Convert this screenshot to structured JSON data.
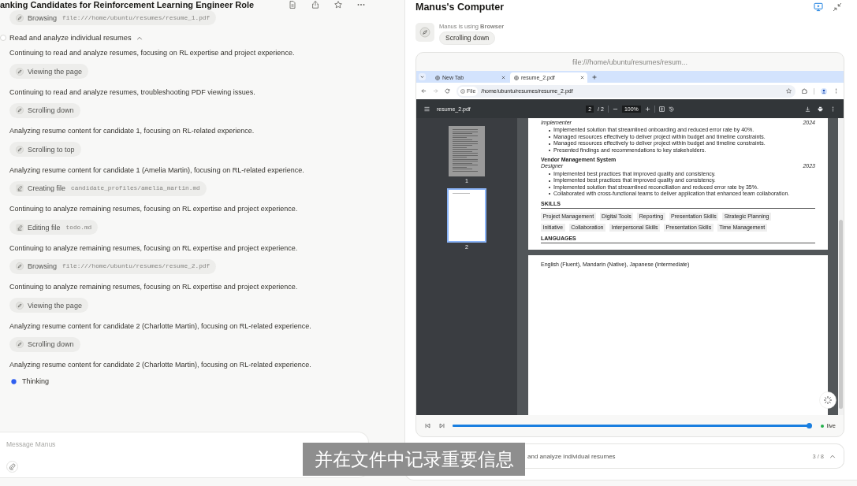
{
  "header": {
    "title": "anking Candidates for Reinforcement Learning Engineer Role"
  },
  "feed": {
    "lead": {
      "kind": "browser",
      "label": "Browsing",
      "detail": "file:///home/ubuntu/resumes/resume_1.pdf"
    },
    "step": {
      "title": "Read and analyze individual resumes",
      "expanded": true
    },
    "entries": [
      {
        "kind": "message",
        "text": "Continuing to read and analyze resumes, focusing on RL expertise and project experience."
      },
      {
        "kind": "browser",
        "label": "Viewing the page"
      },
      {
        "kind": "message",
        "text": "Continuing to read and analyze resumes, troubleshooting PDF viewing issues."
      },
      {
        "kind": "browser",
        "label": "Scrolling down"
      },
      {
        "kind": "message",
        "text": "Analyzing resume content for candidate 1, focusing on RL-related experience."
      },
      {
        "kind": "browser",
        "label": "Scrolling to top"
      },
      {
        "kind": "message",
        "text": "Analyzing resume content for candidate 1 (Amelia Martin), focusing on RL-related experience."
      },
      {
        "kind": "editor",
        "label": "Creating file",
        "detail": "candidate_profiles/amelia_martin.md"
      },
      {
        "kind": "message",
        "text": "Continuing to analyze remaining resumes, focusing on RL expertise and project experience."
      },
      {
        "kind": "editor",
        "label": "Editing file",
        "detail": "todo.md"
      },
      {
        "kind": "message",
        "text": "Continuing to analyze remaining resumes, focusing on RL expertise and project experience."
      },
      {
        "kind": "browser",
        "label": "Browsing",
        "detail": "file:///home/ubuntu/resumes/resume_2.pdf"
      },
      {
        "kind": "message",
        "text": "Continuing to analyze remaining resumes, focusing on RL expertise and project experience."
      },
      {
        "kind": "browser",
        "label": "Viewing the page"
      },
      {
        "kind": "message",
        "text": "Analyzing resume content for candidate 2 (Charlotte Martin), focusing on RL-related experience."
      },
      {
        "kind": "browser",
        "label": "Scrolling down"
      },
      {
        "kind": "message",
        "text": "Analyzing resume content for candidate 2 (Charlotte Martin), focusing on RL-related experience."
      }
    ],
    "thinking": "Thinking"
  },
  "composer": {
    "placeholder": "Message Manus"
  },
  "computer": {
    "title": "Manus's Computer",
    "agent_status": "Manus is using **Browser**",
    "action": "Scrolling down",
    "url": "file:///home/ubuntu/resumes/resum...",
    "browser": {
      "tabs": [
        {
          "title": "New Tab",
          "selected": false
        },
        {
          "title": "resume_2.pdf",
          "selected": true
        }
      ],
      "site_chip": "File",
      "address": "/home/ubuntu/resumes/resume_2.pdf"
    },
    "pdf": {
      "file_name": "resume_2.pdf",
      "page": "2",
      "page_total": "/ 2",
      "zoom": "100%",
      "thumbnails": [
        {
          "label": "1",
          "kind": "full",
          "selected": false
        },
        {
          "label": "2",
          "kind": "short",
          "selected": true
        }
      ],
      "pages": [
        {
          "blocks": [
            {
              "kind": "role",
              "text": "Implementer",
              "year": "2024"
            },
            {
              "kind": "bullets",
              "items": [
                "Implemented solution that streamlined onboarding and reduced error rate by 40%.",
                "Managed resources effectively to deliver project within budget and timeline constraints.",
                "Managed resources effectively to deliver project within budget and timeline constraints.",
                "Presented findings and recommendations to key stakeholders."
              ]
            },
            {
              "kind": "project",
              "text": "Vendor Management System"
            },
            {
              "kind": "role",
              "text": "Designer",
              "year": "2023"
            },
            {
              "kind": "bullets",
              "items": [
                "Implemented best practices that improved quality and consistency.",
                "Implemented best practices that improved quality and consistency.",
                "Implemented solution that streamlined reconciliation and reduced error rate by 35%.",
                "Collaborated with cross-functional teams to deliver application that enhanced team collaboration."
              ]
            },
            {
              "kind": "heading",
              "text": "SKILLS"
            },
            {
              "kind": "tags",
              "items": [
                "Project Management",
                "Digital Tools",
                "Reporting",
                "Presentation Skills",
                "Strategic Planning",
                "Initiative",
                "Collaboration",
                "Interpersonal Skills",
                "Presentation Skills",
                "Time Management"
              ]
            },
            {
              "kind": "heading",
              "text": "LANGUAGES"
            }
          ]
        },
        {
          "blocks": [
            {
              "kind": "paragraph",
              "text": "English (Fluent), Mandarin (Native), Japanese (Intermediate)"
            }
          ]
        }
      ]
    },
    "playback": {
      "level": 1,
      "live": "live"
    },
    "task": {
      "text": "and analyze individual resumes",
      "progress": "3 / 8"
    }
  },
  "subtitle": "并在文件中记录重要信息"
}
